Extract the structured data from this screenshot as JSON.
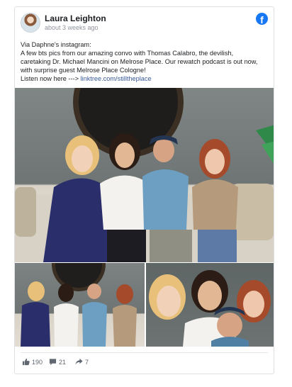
{
  "post": {
    "author": "Laura Leighton",
    "time": "about 3 weeks ago",
    "text_lines": [
      "Via Daphne's instagram:",
      "A few bts pics from our amazing convo with Thomas Calabro, the devilish,",
      "caretaking Dr. Michael Mancini on Melrose Place. Our rewatch podcast is out now,",
      "with surprise guest Melrose Place Cologne!"
    ],
    "listen_prefix": "Listen now here ---> ",
    "link": "linktree.com/stilltheplace"
  },
  "stats": {
    "likes": "190",
    "comments": "21",
    "shares": "7"
  },
  "icons": {
    "platform": "facebook-icon",
    "like": "thumbs-up-icon",
    "comment": "comment-icon",
    "share": "share-icon"
  },
  "colors": {
    "facebook_blue": "#1877f2",
    "link": "#385898",
    "muted": "#90949c"
  }
}
